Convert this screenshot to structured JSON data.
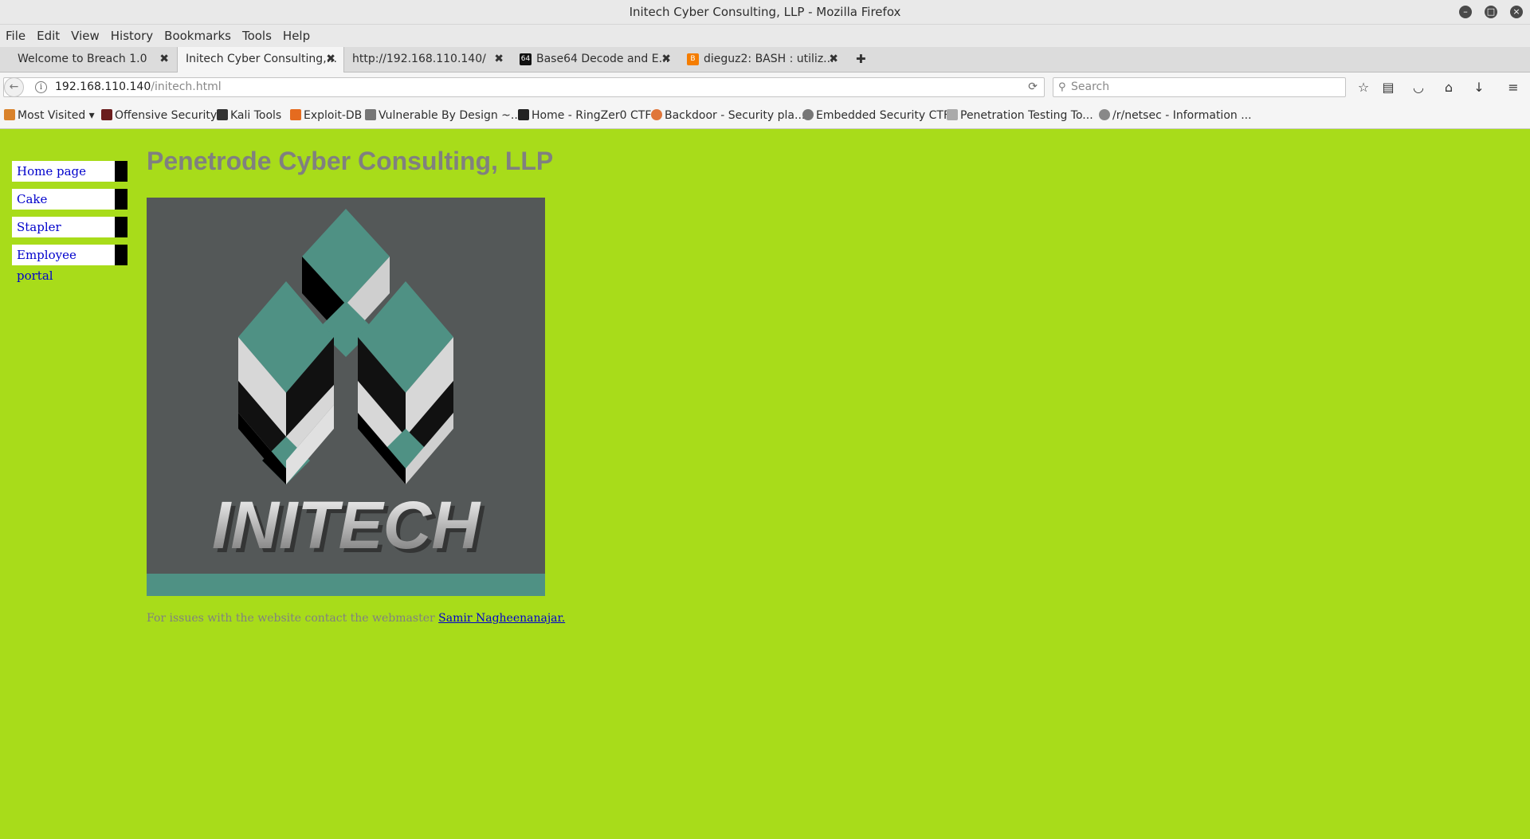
{
  "window": {
    "title": "Initech Cyber Consulting, LLP - Mozilla Firefox"
  },
  "menu": [
    "File",
    "Edit",
    "View",
    "History",
    "Bookmarks",
    "Tools",
    "Help"
  ],
  "tabs": [
    {
      "label": "Welcome to Breach 1.0",
      "active": false,
      "favicon": ""
    },
    {
      "label": "Initech Cyber Consulting,...",
      "active": true,
      "favicon": ""
    },
    {
      "label": "http://192.168.110.140/",
      "active": false,
      "favicon": ""
    },
    {
      "label": "Base64 Decode and E...",
      "active": false,
      "favicon": "64"
    },
    {
      "label": "dieguz2: BASH : utiliz...",
      "active": false,
      "favicon": "B"
    }
  ],
  "new_tab_glyph": "✚",
  "close_glyph": "✖",
  "navbar": {
    "url_host": "192.168.110.140",
    "url_path": "/initech.html",
    "search_placeholder": "Search"
  },
  "bookmarks": [
    {
      "label": "Most Visited ▾",
      "icon": "folder-icon",
      "color": "#d9822b"
    },
    {
      "label": "Offensive Security",
      "icon": "offsec-icon",
      "color": "#6b1d1d"
    },
    {
      "label": "Kali Tools",
      "icon": "kali-icon",
      "color": "#333333"
    },
    {
      "label": "Exploit-DB",
      "icon": "exploitdb-icon",
      "color": "#e56b1f"
    },
    {
      "label": "Vulnerable By Design ~...",
      "icon": "vulnhub-icon",
      "color": "#777777"
    },
    {
      "label": "Home - RingZer0 CTF",
      "icon": "ringzer0-icon",
      "color": "#222222"
    },
    {
      "label": "Backdoor - Security pla...",
      "icon": "backdoor-icon",
      "color": "#e0763a"
    },
    {
      "label": "Embedded Security CTF",
      "icon": "globe-icon",
      "color": "#777777"
    },
    {
      "label": "Penetration Testing To...",
      "icon": "pentest-icon",
      "color": "#aaaaaa"
    },
    {
      "label": "/r/netsec - Information ...",
      "icon": "reddit-icon",
      "color": "#888888"
    }
  ],
  "page": {
    "nav": [
      "Home page",
      "Cake",
      "Stapler",
      "Employee portal"
    ],
    "heading": "Penetrode Cyber Consulting, LLP",
    "logo_text": "INITECH",
    "footer_text": "For issues with the website contact the webmaster",
    "footer_link": "Samir Nagheenanajar."
  },
  "colors": {
    "page_background": "#a8dc1a",
    "logo_background": "#545858",
    "logo_teal": "#4f9184",
    "heading": "#808080",
    "link": "#0000cc"
  }
}
